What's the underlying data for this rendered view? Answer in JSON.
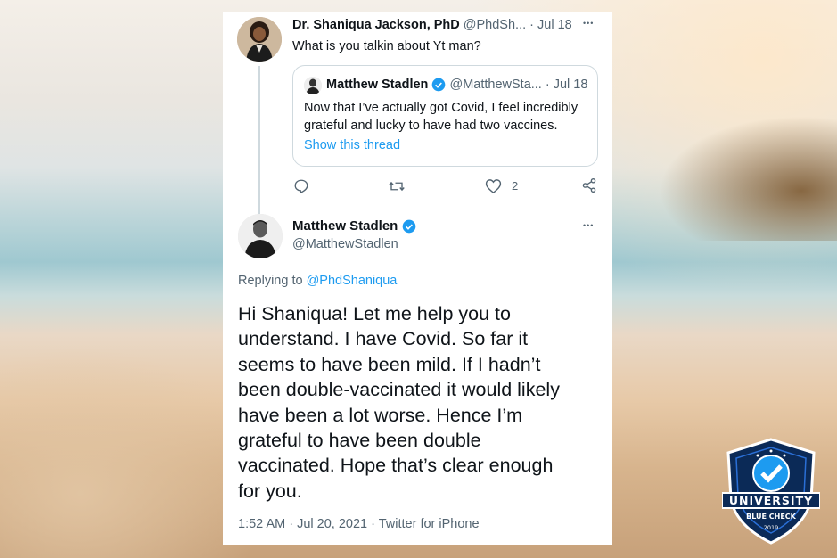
{
  "tweet1": {
    "name": "Dr. Shaniqua Jackson, PhD",
    "handle": "@PhdSh...",
    "date": "· Jul 18",
    "text": "What is you talkin about Yt man?",
    "more": "•••",
    "like_count": "2"
  },
  "quoted": {
    "name": "Matthew Stadlen",
    "handle": "@MatthewSta...",
    "date": "· Jul 18",
    "text_line1": "Now that I’ve actually got Covid, I feel incredibly",
    "text_line2": "grateful and lucky to have had two vaccines.",
    "show_thread": "Show this thread"
  },
  "tweet2": {
    "name": "Matthew Stadlen",
    "handle": "@MatthewStadlen",
    "more": "•••",
    "replying_prefix": "Replying to",
    "replying_handle": "@PhdShaniqua",
    "body_lines": [
      "Hi Shaniqua! Let me help you to",
      "understand. I have Covid. So far it",
      "seems to have been mild. If I hadn’t",
      "been double-vaccinated it would likely",
      "have been a lot worse. Hence I’m",
      "grateful to have been double",
      "vaccinated. Hope that’s clear enough",
      "for you."
    ],
    "meta": "1:52 AM · Jul 20, 2021 · Twitter for iPhone"
  },
  "badge": {
    "line1": "UNIVERSITY",
    "line2": "BLUE CHECK",
    "year": "2019"
  },
  "icons": {
    "reply": "reply-icon",
    "retweet": "retweet-icon",
    "like": "heart-icon",
    "share": "share-icon",
    "verified": "verified-check-icon"
  },
  "colors": {
    "link": "#1d9bf0",
    "verified": "#1d9bf0",
    "badge_navy": "#0b2a57"
  }
}
